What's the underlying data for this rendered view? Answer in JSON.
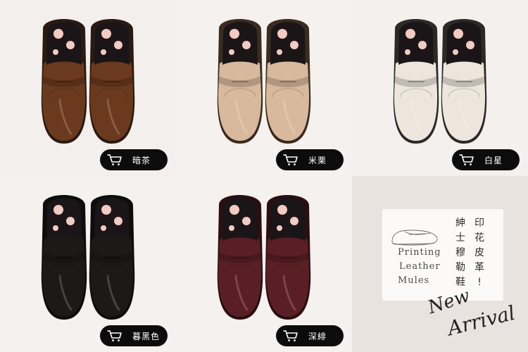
{
  "products": [
    {
      "label": "暗茶",
      "icon": "cart-icon",
      "color": "#6b3a1e",
      "sole": "#2a1a12"
    },
    {
      "label": "米栗",
      "icon": "cart-icon",
      "color": "#d9b99c",
      "sole": "#3b2b20"
    },
    {
      "label": "白星",
      "icon": "cart-icon",
      "color": "#eee6dc",
      "sole": "#2c2a27"
    },
    {
      "label": "暮黑色",
      "icon": "cart-icon",
      "color": "#1b1a19",
      "sole": "#0d0d0d"
    },
    {
      "label": "深緋",
      "icon": "cart-icon",
      "color": "#5a1f24",
      "sole": "#2a0f12"
    }
  ],
  "promo": {
    "en_line1": "Printing",
    "en_line2": "Leather",
    "en_line3": "Mules",
    "zh_col_a": [
      "紳",
      "士",
      "穆",
      "勒",
      "鞋"
    ],
    "zh_col_b": [
      "印",
      "花",
      "皮",
      "革",
      "!"
    ],
    "script_word1": "New",
    "script_word2": "Arrival"
  },
  "colors": {
    "button_bg": "#0c0c0c",
    "button_text": "#ffffff",
    "insole_dark": "#1a1618",
    "insole_flower": "#f4c9c4"
  }
}
